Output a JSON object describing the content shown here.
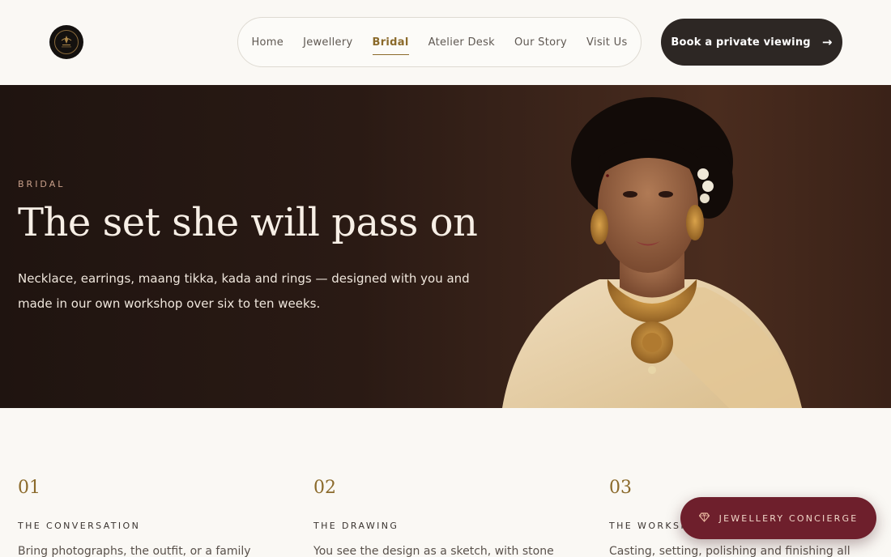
{
  "header": {
    "logo_icon": "jewellery-brand-logo",
    "nav": [
      {
        "label": "Home",
        "active": false
      },
      {
        "label": "Jewellery",
        "active": false
      },
      {
        "label": "Bridal",
        "active": true
      },
      {
        "label": "Atelier Desk",
        "active": false
      },
      {
        "label": "Our Story",
        "active": false
      },
      {
        "label": "Visit Us",
        "active": false
      }
    ],
    "cta_label": "Book a private viewing",
    "cta_icon": "arrow-right-icon"
  },
  "hero": {
    "eyebrow": "BRIDAL",
    "title": "The set she will pass on",
    "text": "Necklace, earrings, maang tikka, kada and rings — designed with you and made in our own workshop over six to ten weeks."
  },
  "steps": [
    {
      "number": "01",
      "title": "THE CONVERSATION",
      "text": "Bring photographs, the outfit, or a family"
    },
    {
      "number": "02",
      "title": "THE DRAWING",
      "text": "You see the design as a sketch, with stone"
    },
    {
      "number": "03",
      "title": "THE WORKSH",
      "text": "Casting, setting, polishing and finishing all"
    }
  ],
  "concierge": {
    "label": "JEWELLERY CONCIERGE",
    "icon": "diamond-icon"
  },
  "colors": {
    "accent_gold": "#8b6a2b",
    "dark_button": "#2d2724",
    "concierge_bg": "#6e1f2c",
    "page_bg": "#faf8f4"
  }
}
